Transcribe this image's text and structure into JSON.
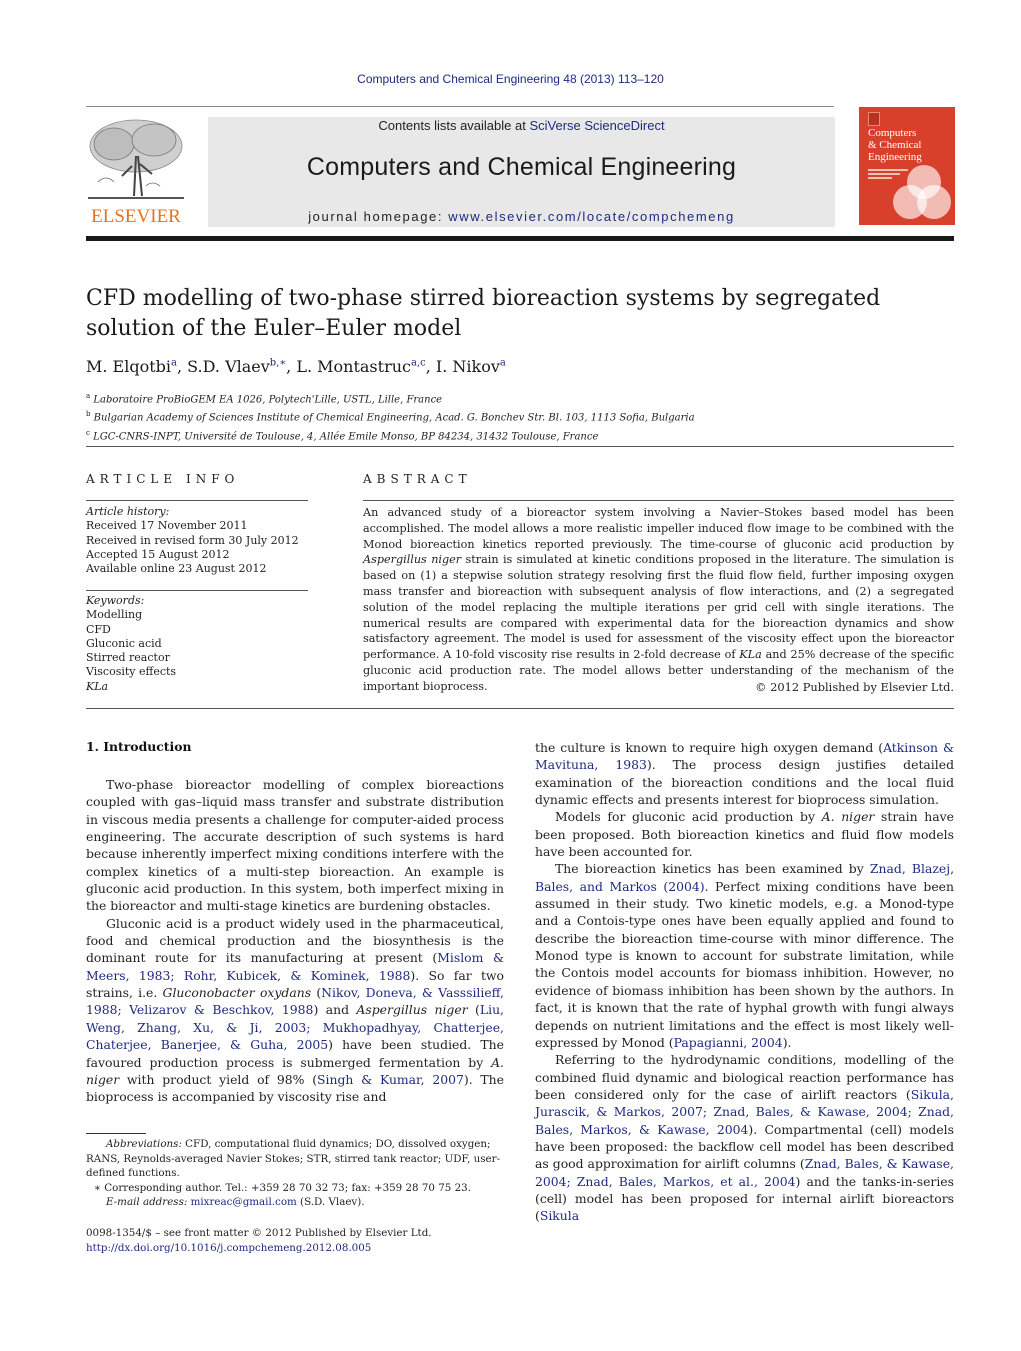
{
  "header": {
    "citation": "Computers and Chemical Engineering 48 (2013) 113–120",
    "publisher_wordmark": "ELSEVIER",
    "contents_prefix": "Contents lists available at ",
    "contents_link": "SciVerse ScienceDirect",
    "journal_name": "Computers and Chemical Engineering",
    "homepage_prefix": "journal homepage: ",
    "homepage_link": "www.elsevier.com/locate/compchemeng",
    "cover": {
      "line1": "Computers",
      "line2": "& Chemical",
      "line3": "Engineering",
      "color": "#d9402b"
    },
    "brand_orange": "#e9711c",
    "link_color": "#1f2a80"
  },
  "article": {
    "title": "CFD modelling of two-phase stirred bioreaction systems by segregated solution of the Euler–Euler model",
    "authors": [
      {
        "name": "M. Elqotbi",
        "sup": "a"
      },
      {
        "name": "S.D. Vlaev",
        "sup": "b,∗"
      },
      {
        "name": "L. Montastruc",
        "sup": "a,c"
      },
      {
        "name": "I. Nikov",
        "sup": "a"
      }
    ],
    "affiliations": [
      {
        "sup": "a",
        "text": "Laboratoire ProBioGEM EA 1026, Polytech'Lille, USTL, Lille, France"
      },
      {
        "sup": "b",
        "text": "Bulgarian Academy of Sciences Institute of Chemical Engineering, Acad. G. Bonchev Str. Bl. 103, 1113 Sofia, Bulgaria"
      },
      {
        "sup": "c",
        "text": "LGC-CNRS-INPT, Université de Toulouse, 4, Allée Emile Monso, BP 84234, 31432 Toulouse, France"
      }
    ]
  },
  "article_info": {
    "heading": "ARTICLE INFO",
    "history_label": "Article history:",
    "history": [
      "Received 17 November 2011",
      "Received in revised form 30 July 2012",
      "Accepted 15 August 2012",
      "Available online 23 August 2012"
    ],
    "keywords_label": "Keywords:",
    "keywords": [
      "Modelling",
      "CFD",
      "Gluconic acid",
      "Stirred reactor",
      "Viscosity effects",
      "KLa"
    ]
  },
  "abstract": {
    "heading": "ABSTRACT",
    "part1": "An advanced study of a bioreactor system involving a Navier–Stokes based model has been accomplished. The model allows a more realistic impeller induced flow image to be combined with the Monod bioreaction kinetics reported previously. The time-course of gluconic acid production by ",
    "species": "Aspergillus niger",
    "part2": " strain is simulated at kinetic conditions proposed in the literature. The simulation is based on (1) a stepwise solution strategy resolving first the fluid flow field, further imposing oxygen mass transfer and bioreaction with subsequent analysis of flow interactions, and (2) a segregated solution of the model replacing the multiple iterations per grid cell with single iterations. The numerical results are compared with experimental data for the bioreaction dynamics and show satisfactory agreement. The model is used for assessment of the viscosity effect upon the bioreactor performance. A 10-fold viscosity rise results in 2-fold decrease of ",
    "kla": "KLa",
    "part3": " and 25% decrease of the specific gluconic acid production rate. The model allows better understanding of the mechanism of the important bioprocess.",
    "copyright": "© 2012 Published by Elsevier Ltd."
  },
  "introduction": {
    "heading": "1.  Introduction",
    "p1": "Two-phase bioreactor modelling of complex bioreactions coupled with gas–liquid mass transfer and substrate distribution in viscous media presents a challenge for computer-aided process engineering. The accurate description of such systems is hard because inherently imperfect mixing conditions interfere with the complex kinetics of a multi-step bioreaction. An example is gluconic acid production. In this system, both imperfect mixing in the bioreactor and multi-stage kinetics are burdening obstacles.",
    "p2": {
      "t1": "Gluconic acid is a product widely used in the pharmaceutical, food and chemical production and the biosynthesis is the dominant route for its manufacturing at present (",
      "r1": "Mislom & Meers, 1983; Rohr, Kubicek, & Kominek, 1988",
      "t2": "). So far two strains, i.e. ",
      "s1": "Gluconobacter oxydans",
      "t3": " (",
      "r2": "Nikov, Doneva, & Vasssilieff, 1988; Velizarov & Beschkov, 1988",
      "t4": ") and ",
      "s2": "Aspergillus niger",
      "t5": " (",
      "r3": "Liu, Weng, Zhang, Xu, & Ji, 2003; Mukhopadhyay, Chatterjee, Chaterjee, Banerjee, & Guha, 2005",
      "t6": ") have been studied. The favoured production process is submerged fermentation by ",
      "s3": "A. niger",
      "t7": " with product yield of 98% (",
      "r4": "Singh & Kumar, 2007",
      "t8": "). The bioprocess is accompanied by viscosity rise and"
    },
    "p2_cont": {
      "t1": "the culture is known to require high oxygen demand (",
      "r1": "Atkinson & Mavituna, 1983",
      "t2": "). The process design justifies detailed examination of the bioreaction conditions and the local fluid dynamic effects and presents interest for bioprocess simulation."
    },
    "p3": {
      "t1": "Models for gluconic acid production by ",
      "s1": "A. niger",
      "t2": " strain have been proposed. Both bioreaction kinetics and fluid flow models have been accounted for."
    },
    "p4": {
      "t1": "The bioreaction kinetics has been examined by ",
      "r1": "Znad, Blazej, Bales, and Markos (2004)",
      "t2": ". Perfect mixing conditions have been assumed in their study. Two kinetic models, e.g. a Monod-type and a Contois-type ones have been equally applied and found to describe the bioreaction time-course with minor difference. The Monod type is known to account for substrate limitation, while the Contois model accounts for biomass inhibition. However, no evidence of biomass inhibition has been shown by the authors. In fact, it is known that the rate of hyphal growth with fungi always depends on nutrient limitations and the effect is most likely well-expressed by Monod (",
      "r2": "Papagianni, 2004",
      "t3": ")."
    },
    "p5": {
      "t1": "Referring to the hydrodynamic conditions, modelling of the combined fluid dynamic and biological reaction performance has been considered only for the case of airlift reactors (",
      "r1": "Sikula, Jurascik, & Markos, 2007; Znad, Bales, & Kawase, 2004; Znad, Bales, Markos, & Kawase, 2004",
      "t2": "). Compartmental (cell) models have been proposed: the backflow cell model has been described as good approximation for airlift columns (",
      "r2": "Znad, Bales, & Kawase, 2004; Znad, Bales, Markos, et al., 2004",
      "t3": ") and the tanks-in-series (cell) model has been proposed for internal airlift bioreactors (",
      "r3": "Sikula"
    }
  },
  "footnotes": {
    "abbrev_label": "Abbreviations:",
    "abbrev_text": " CFD, computational fluid dynamics; DO, dissolved oxygen; RANS, Reynolds-averaged Navier Stokes; STR, stirred tank reactor; UDF, user-defined functions.",
    "corresponding": "∗  Corresponding author. Tel.: +359 28 70 32 73; fax: +359 28 70 75 23.",
    "email_label": "E-mail address:",
    "email": "mixreac@gmail.com",
    "email_suffix": " (S.D. Vlaev).",
    "issn_line": "0098-1354/$ – see front matter © 2012 Published by Elsevier Ltd.",
    "doi": "http://dx.doi.org/10.1016/j.compchemeng.2012.08.005"
  }
}
